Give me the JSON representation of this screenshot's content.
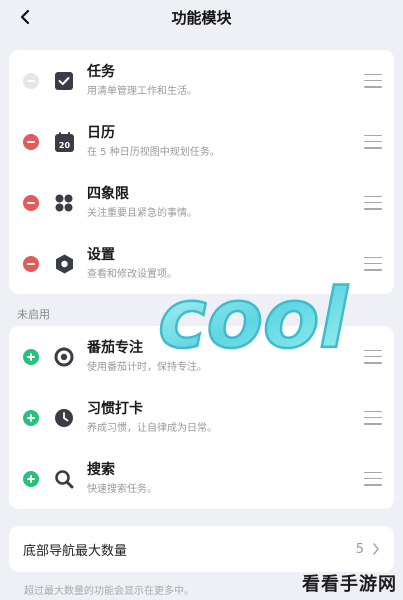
{
  "header": {
    "title": "功能模块"
  },
  "enabled_items": [
    {
      "name": "任务",
      "desc": "用清单管理工作和生活。",
      "icon": "checkbox-icon",
      "toggle": "remove-disabled"
    },
    {
      "name": "日历",
      "desc": "在 5 种日历视图中规划任务。",
      "icon": "calendar-icon",
      "icon_text": "20",
      "toggle": "remove"
    },
    {
      "name": "四象限",
      "desc": "关注重要且紧急的事情。",
      "icon": "four-dots-icon",
      "toggle": "remove"
    },
    {
      "name": "设置",
      "desc": "查看和修改设置项。",
      "icon": "hexagon-settings-icon",
      "toggle": "remove"
    }
  ],
  "section_label": "未启用",
  "disabled_items": [
    {
      "name": "番茄专注",
      "desc": "使用番茄计时，保持专注。",
      "icon": "target-icon",
      "toggle": "add"
    },
    {
      "name": "习惯打卡",
      "desc": "养成习惯，让自律成为日常。",
      "icon": "clock-icon",
      "toggle": "add"
    },
    {
      "name": "搜索",
      "desc": "快速搜索任务。",
      "icon": "search-icon",
      "toggle": "add"
    }
  ],
  "nav": {
    "label": "底部导航最大数量",
    "value": "5"
  },
  "footer_note": "超过最大数量的功能会显示在更多中。",
  "overlay": {
    "sticker_text": "cool",
    "watermark": "看看手游网"
  },
  "colors": {
    "remove": "#e25a5a",
    "add": "#27c07d",
    "background": "#eef0f5"
  }
}
